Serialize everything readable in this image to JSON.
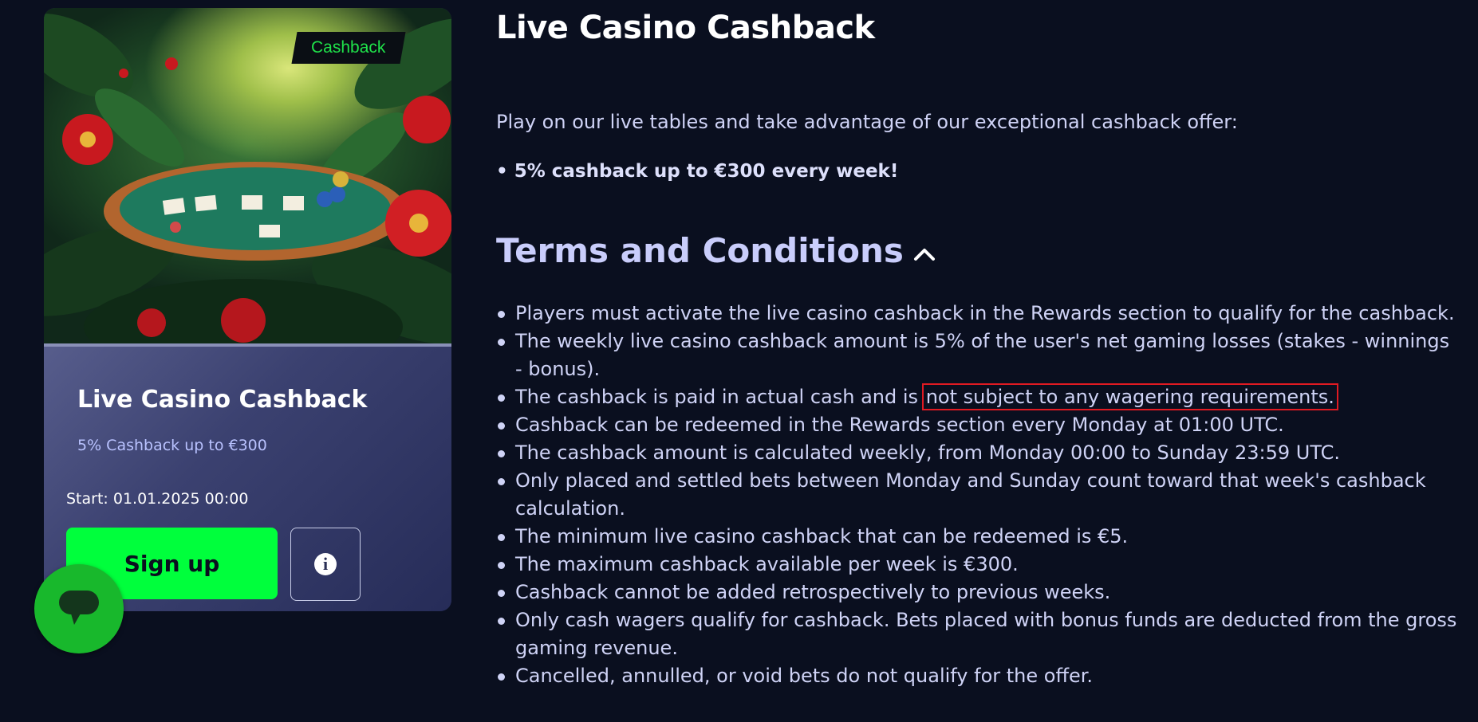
{
  "card": {
    "badge": "Cashback",
    "title": "Live Casino Cashback",
    "subtitle": "5% Cashback up to €300",
    "start": "Start: 01.01.2025 00:00",
    "signup_label": "Sign up",
    "info_icon": "info-icon",
    "info_glyph": "i"
  },
  "chat": {
    "icon": "chat-icon"
  },
  "content": {
    "title": "Live Casino Cashback",
    "intro": "Play on our live tables and take advantage of our exceptional cashback offer:",
    "highlight": "• 5% cashback up to €300 every week!",
    "terms_heading": "Terms and Conditions",
    "terms": [
      {
        "text": "Players must activate the live casino cashback in the Rewards section to qualify for the cashback."
      },
      {
        "text": "The weekly live casino cashback amount is 5% of the user's net gaming losses (stakes - winnings - bonus)."
      },
      {
        "text": "The cashback is paid in actual cash and is ",
        "marked": "not subject to any wagering requirements."
      },
      {
        "text": "Cashback can be redeemed in the Rewards section every Monday at 01:00 UTC."
      },
      {
        "text": "The cashback amount is calculated weekly, from Monday 00:00 to Sunday 23:59 UTC."
      },
      {
        "text": "Only placed and settled bets between Monday and Sunday count toward that week's cashback calculation."
      },
      {
        "text": "The minimum live casino cashback that can be redeemed is €5."
      },
      {
        "text": "The maximum cashback available per week is €300."
      },
      {
        "text": "Cashback cannot be added retrospectively to previous weeks."
      },
      {
        "text": "Only cash wagers qualify for cashback. Bets placed with bonus funds are deducted from the gross gaming revenue."
      },
      {
        "text": "Cancelled, annulled, or void bets do not qualify for the offer."
      }
    ]
  },
  "colors": {
    "accent_green": "#00ff3c",
    "badge_text": "#1fe34a",
    "highlight_box": "#e01a22",
    "background": "#0a0f1f"
  }
}
